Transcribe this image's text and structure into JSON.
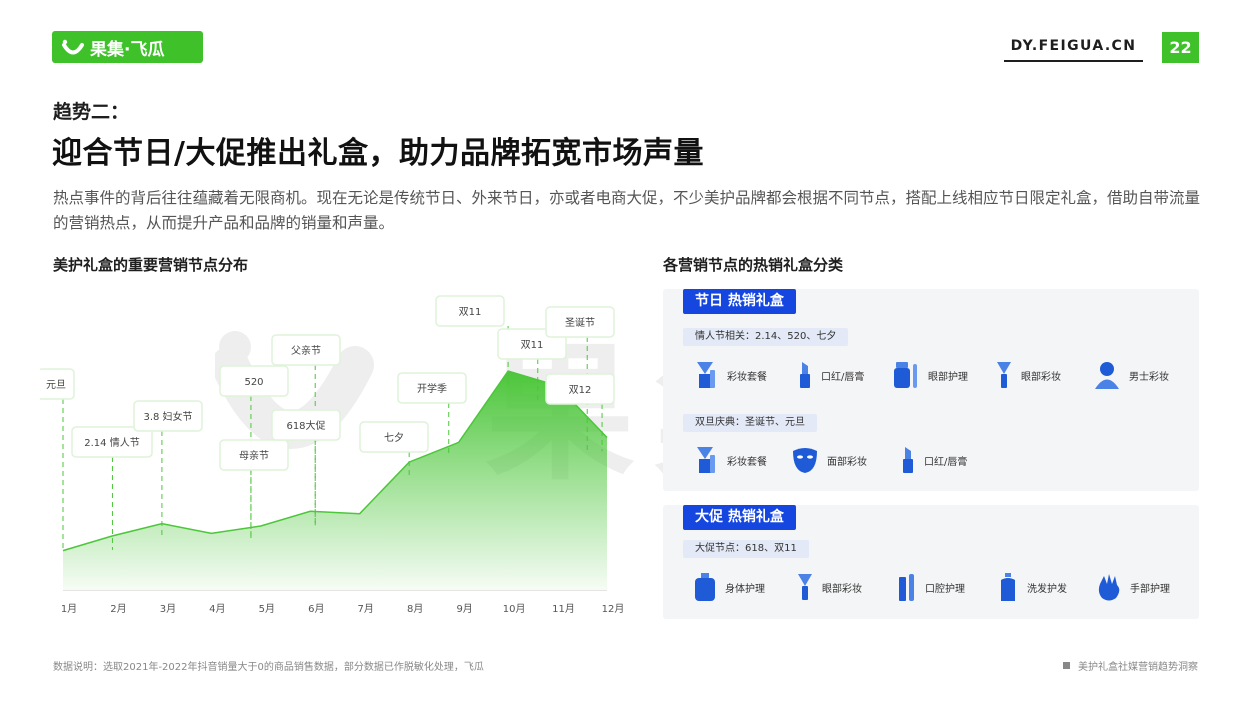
{
  "header": {
    "logo_text": "果集·飞瓜",
    "site": "DY.FEIGUA.CN",
    "page_number": "22",
    "trend_label": "趋势二：",
    "title": "迎合节日/大促推出礼盒，助力品牌拓宽市场声量",
    "description": "热点事件的背后往往蕴藏着无限商机。现在无论是传统节日、外来节日，亦或者电商大促，不少美护品牌都会根据不同节点，搭配上线相应节日限定礼盒，借助自带流量的营销热点，从而提升产品和品牌的销量和声量。"
  },
  "watermark": "果集·飞瓜",
  "left_section_title": "美护礼盒的重要营销节点分布",
  "right_section_title": "各营销节点的热销礼盒分类",
  "chart_data": {
    "type": "area",
    "categories": [
      "1月",
      "2月",
      "3月",
      "4月",
      "5月",
      "6月",
      "7月",
      "8月",
      "9月",
      "10月",
      "11月",
      "12月"
    ],
    "values": [
      16,
      22,
      27,
      23,
      26,
      32,
      31,
      52,
      60,
      89,
      83,
      62
    ],
    "ylim": [
      0,
      100
    ],
    "color": "#4cc63a",
    "annotations": [
      {
        "label": "元旦",
        "x": 1.0
      },
      {
        "label": "2.14 情人节",
        "x": 2.0
      },
      {
        "label": "3.8 妇女节",
        "x": 3.0
      },
      {
        "label": "520",
        "x": 4.8
      },
      {
        "label": "母亲节",
        "x": 4.8
      },
      {
        "label": "父亲节",
        "x": 6.1
      },
      {
        "label": "618大促",
        "x": 6.1
      },
      {
        "label": "七夕",
        "x": 8.0
      },
      {
        "label": "开学季",
        "x": 8.8
      },
      {
        "label": "双11",
        "x": 10.0
      },
      {
        "label": "双11",
        "x": 10.6
      },
      {
        "label": "圣诞节",
        "x": 11.6
      },
      {
        "label": "双12",
        "x": 11.9
      }
    ]
  },
  "panels": {
    "festival": {
      "head": "节日 热销礼盒",
      "chip1": "情人节相关：2.14、520、七夕",
      "row1": [
        "彩妆套餐",
        "口红/唇膏",
        "眼部护理",
        "眼部彩妆",
        "男士彩妆"
      ],
      "chip2": "双旦庆典：圣诞节、元旦",
      "row2": [
        "彩妆套餐",
        "面部彩妆",
        "口红/唇膏"
      ]
    },
    "promo": {
      "head": "大促 热销礼盒",
      "chip": "大促节点：618、双11",
      "row": [
        "身体护理",
        "眼部彩妆",
        "口腔护理",
        "洗发护发",
        "手部护理"
      ]
    }
  },
  "icons": {
    "festival_row1": [
      "makeup-kit-icon",
      "lipstick-icon",
      "eye-care-icon",
      "eye-makeup-icon",
      "man-icon"
    ],
    "festival_row2": [
      "makeup-kit-icon",
      "face-mask-icon",
      "lipstick-icon"
    ],
    "promo_row": [
      "body-care-bottle-icon",
      "eye-makeup-icon",
      "oral-care-icon",
      "shampoo-icon",
      "hand-icon"
    ]
  },
  "footer": {
    "note": "数据说明：选取2021年-2022年抖音销量大于0的商品销售数据，部分数据已作脱敏化处理，飞瓜",
    "report": "美护礼盒社媒营销趋势洞察"
  }
}
